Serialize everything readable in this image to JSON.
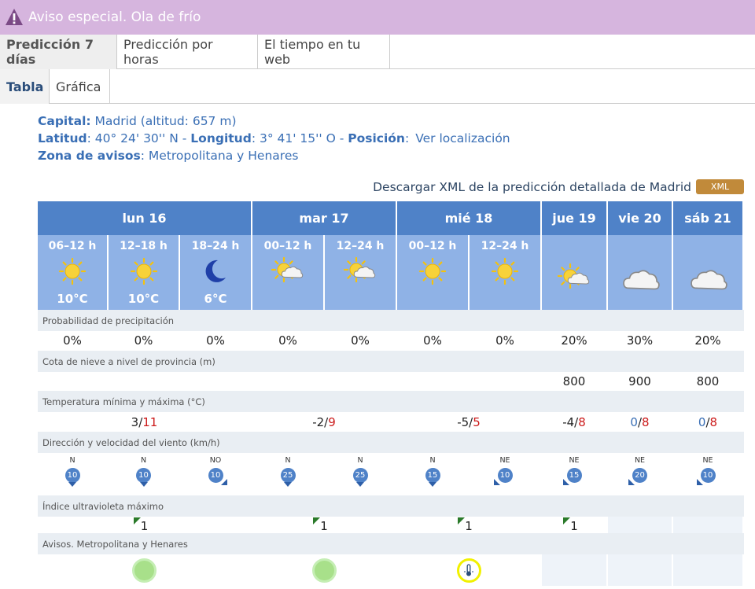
{
  "alert": {
    "text": "Aviso especial. Ola de frío"
  },
  "tabs_main": [
    {
      "label": "Predicción 7 días",
      "active": true
    },
    {
      "label": "Predicción por horas",
      "active": false
    },
    {
      "label": "El tiempo en tu web",
      "active": false
    }
  ],
  "tabs_sub": [
    {
      "label": "Tabla",
      "active": true
    },
    {
      "label": "Gráfica",
      "active": false
    }
  ],
  "info": {
    "capital_label": "Capital:",
    "capital_value": " Madrid (altitud: 657 m)",
    "lat_label": "Latitud",
    "lat_value": ": 40° 24' 30'' N - ",
    "lon_label": "Longitud",
    "lon_value": ": 3° 41' 15'' O - ",
    "pos_label": "Posición",
    "pos_sep": ":",
    "pos_link": "Ver localización",
    "zona_label": "Zona de avisos",
    "zona_value": ": Metropolitana y Henares"
  },
  "download": {
    "text": "Descargar XML de la predicción detallada de Madrid",
    "badge": "XML"
  },
  "days": [
    "lun 16",
    "mar 17",
    "mié 18",
    "jue 19",
    "vie 20",
    "sáb 21"
  ],
  "periods": [
    {
      "label": "06–12 h",
      "icon": "sun-icon",
      "temp": "10°C"
    },
    {
      "label": "12–18 h",
      "icon": "sun-icon",
      "temp": "10°C"
    },
    {
      "label": "18–24 h",
      "icon": "moon-icon",
      "temp": "6°C"
    },
    {
      "label": "00–12 h",
      "icon": "sun-cloud-icon",
      "temp": ""
    },
    {
      "label": "12–24 h",
      "icon": "sun-cloud-icon",
      "temp": ""
    },
    {
      "label": "00–12 h",
      "icon": "sun-icon",
      "temp": ""
    },
    {
      "label": "12–24 h",
      "icon": "sun-icon",
      "temp": ""
    },
    {
      "label": "",
      "icon": "sun-cloud-icon",
      "temp": ""
    },
    {
      "label": "",
      "icon": "cloud-icon",
      "temp": ""
    },
    {
      "label": "",
      "icon": "cloud-icon",
      "temp": ""
    }
  ],
  "labels": {
    "precip": "Probabilidad de precipitación",
    "snow": "Cota de nieve a nivel de provincia (m)",
    "temp": "Temperatura mínima y máxima (°C)",
    "wind": "Dirección y velocidad del viento (km/h)",
    "uv": "Índice ultravioleta máximo",
    "avisos": "Avisos. Metropolitana y Henares"
  },
  "precip": [
    "0%",
    "0%",
    "0%",
    "0%",
    "0%",
    "0%",
    "0%",
    "20%",
    "30%",
    "20%"
  ],
  "snow": [
    "",
    "",
    "",
    "",
    "",
    "",
    "",
    "800",
    "900",
    "800"
  ],
  "temps": [
    {
      "min": "3",
      "max": "11"
    },
    {
      "min": "-2",
      "max": "9"
    },
    {
      "min": "-5",
      "max": "5"
    },
    {
      "min": "-4",
      "max": "8"
    },
    {
      "min": "0",
      "max": "8"
    },
    {
      "min": "0",
      "max": "8"
    }
  ],
  "temp_sep": "/",
  "wind": [
    {
      "dir": "N",
      "speed": "10"
    },
    {
      "dir": "N",
      "speed": "10"
    },
    {
      "dir": "NO",
      "speed": "10"
    },
    {
      "dir": "N",
      "speed": "25"
    },
    {
      "dir": "N",
      "speed": "25"
    },
    {
      "dir": "N",
      "speed": "15"
    },
    {
      "dir": "NE",
      "speed": "10"
    },
    {
      "dir": "NE",
      "speed": "15"
    },
    {
      "dir": "NE",
      "speed": "20"
    },
    {
      "dir": "NE",
      "speed": "10"
    }
  ],
  "uv": [
    "1",
    "1",
    "1",
    "1",
    "",
    ""
  ],
  "avisos": [
    "green",
    "green",
    "yellow-cold",
    "",
    "",
    ""
  ],
  "colors": {
    "header": "#4f82c8",
    "subheader": "#8fb2e6",
    "label_bg": "#e9eef3",
    "alert_bg": "#d6b5de",
    "max_red": "#cc1b1b"
  }
}
